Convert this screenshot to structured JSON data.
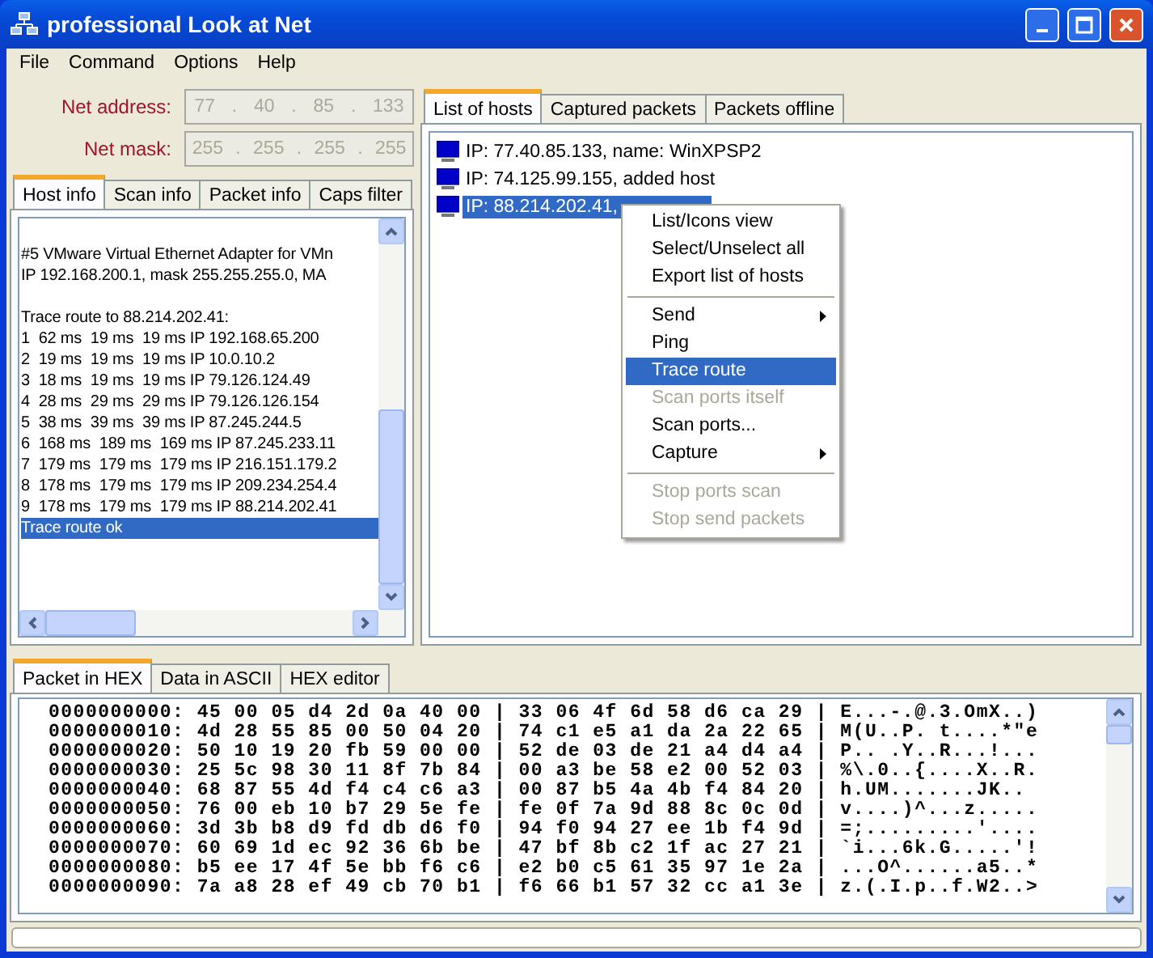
{
  "window": {
    "title": "professional Look at Net"
  },
  "menu": [
    "File",
    "Command",
    "Options",
    "Help"
  ],
  "net_fields": [
    {
      "label": "Net address:",
      "octets": [
        "77",
        "40",
        "85",
        "133"
      ],
      "separator": ".",
      "disabled": true
    },
    {
      "label": "Net mask:",
      "octets": [
        "255",
        "255",
        "255",
        "255"
      ],
      "separator": ".",
      "disabled": true
    }
  ],
  "left_tabs": [
    {
      "label": "Host info",
      "selected": true
    },
    {
      "label": "Scan info",
      "selected": false
    },
    {
      "label": "Packet info",
      "selected": false
    },
    {
      "label": "Caps filter",
      "selected": false
    }
  ],
  "host_info": {
    "blocks": [
      {
        "lines": [
          {
            "text": "#5 VMware Virtual Ethernet Adapter for VMn",
            "selected": false
          },
          {
            "text": "IP 192.168.200.1, mask 255.255.255.0, MA",
            "selected": false
          }
        ]
      },
      {
        "lines": [
          {
            "text": "Trace route to 88.214.202.41:",
            "selected": false
          },
          {
            "text": "1  62 ms  19 ms  19 ms IP 192.168.65.200",
            "selected": false
          },
          {
            "text": "2  19 ms  19 ms  19 ms IP 10.0.10.2",
            "selected": false
          },
          {
            "text": "3  18 ms  19 ms  19 ms IP 79.126.124.49",
            "selected": false
          },
          {
            "text": "4  28 ms  29 ms  29 ms IP 79.126.126.154",
            "selected": false
          },
          {
            "text": "5  38 ms  39 ms  39 ms IP 87.245.244.5",
            "selected": false
          },
          {
            "text": "6  168 ms  189 ms  169 ms IP 87.245.233.11",
            "selected": false
          },
          {
            "text": "7  179 ms  179 ms  179 ms IP 216.151.179.2",
            "selected": false
          },
          {
            "text": "8  178 ms  179 ms  179 ms IP 209.234.254.4",
            "selected": false
          },
          {
            "text": "9  178 ms  179 ms  179 ms IP 88.214.202.41",
            "selected": false
          },
          {
            "text": "Trace route ok",
            "selected": true
          }
        ]
      }
    ]
  },
  "right_tabs": [
    {
      "label": "List of hosts",
      "selected": true
    },
    {
      "label": "Captured packets",
      "selected": false
    },
    {
      "label": "Packets offline",
      "selected": false
    }
  ],
  "hosts": [
    {
      "text": "IP: 77.40.85.133, name: WinXPSP2",
      "selected": false
    },
    {
      "text": "IP: 74.125.99.155, added host",
      "selected": false
    },
    {
      "text": "IP: 88.214.202.41,",
      "selected": true
    }
  ],
  "context_menu": [
    {
      "kind": "item",
      "label": "List/Icons view",
      "disabled": false,
      "selected": false,
      "submenu": false
    },
    {
      "kind": "item",
      "label": "Select/Unselect all",
      "disabled": false,
      "selected": false,
      "submenu": false
    },
    {
      "kind": "item",
      "label": "Export list of hosts",
      "disabled": false,
      "selected": false,
      "submenu": false
    },
    {
      "kind": "separator"
    },
    {
      "kind": "item",
      "label": "Send",
      "disabled": false,
      "selected": false,
      "submenu": true
    },
    {
      "kind": "item",
      "label": "Ping",
      "disabled": false,
      "selected": false,
      "submenu": false
    },
    {
      "kind": "item",
      "label": "Trace route",
      "disabled": false,
      "selected": true,
      "submenu": false
    },
    {
      "kind": "item",
      "label": "Scan ports itself",
      "disabled": true,
      "selected": false,
      "submenu": false
    },
    {
      "kind": "item",
      "label": "Scan ports...",
      "disabled": false,
      "selected": false,
      "submenu": false
    },
    {
      "kind": "item",
      "label": "Capture",
      "disabled": false,
      "selected": false,
      "submenu": true
    },
    {
      "kind": "separator"
    },
    {
      "kind": "item",
      "label": "Stop ports scan",
      "disabled": true,
      "selected": false,
      "submenu": false
    },
    {
      "kind": "item",
      "label": "Stop send packets",
      "disabled": true,
      "selected": false,
      "submenu": false
    }
  ],
  "bottom_tabs": [
    {
      "label": "Packet in HEX",
      "selected": true
    },
    {
      "label": "Data in ASCII",
      "selected": false
    },
    {
      "label": "HEX editor",
      "selected": false
    }
  ],
  "hex_rows": [
    {
      "offset": "0000000000:",
      "bytes": "45 00 05 d4 2d 0a 40 00 | 33 06 4f 6d 58 d6 ca 29 |",
      "ascii": "E...-.@.3.OmX..)"
    },
    {
      "offset": "0000000010:",
      "bytes": "4d 28 55 85 00 50 04 20 | 74 c1 e5 a1 da 2a 22 65 |",
      "ascii": "M(U..P. t....*\"e"
    },
    {
      "offset": "0000000020:",
      "bytes": "50 10 19 20 fb 59 00 00 | 52 de 03 de 21 a4 d4 a4 |",
      "ascii": "P.. .Y..R...!..."
    },
    {
      "offset": "0000000030:",
      "bytes": "25 5c 98 30 11 8f 7b 84 | 00 a3 be 58 e2 00 52 03 |",
      "ascii": "%\\.0..{....X..R."
    },
    {
      "offset": "0000000040:",
      "bytes": "68 87 55 4d f4 c4 c6 a3 | 00 87 b5 4a 4b f4 84 20 |",
      "ascii": "h.UM.......JK.."
    },
    {
      "offset": "0000000050:",
      "bytes": "76 00 eb 10 b7 29 5e fe | fe 0f 7a 9d 88 8c 0c 0d |",
      "ascii": "v....)^...z....."
    },
    {
      "offset": "0000000060:",
      "bytes": "3d 3b b8 d9 fd db d6 f0 | 94 f0 94 27 ee 1b f4 9d |",
      "ascii": "=;.........'...."
    },
    {
      "offset": "0000000070:",
      "bytes": "60 69 1d ec 92 36 6b be | 47 bf 8b c2 1f ac 27 21 |",
      "ascii": "`i...6k.G.....'!"
    },
    {
      "offset": "0000000080:",
      "bytes": "b5 ee 17 4f 5e bb f6 c6 | e2 b0 c5 61 35 97 1e 2a |",
      "ascii": "...O^......a5..*"
    },
    {
      "offset": "0000000090:",
      "bytes": "7a a8 28 ef 49 cb 70 b1 | f6 66 b1 57 32 cc a1 3e |",
      "ascii": "z.(.I.p..f.W2..>"
    }
  ]
}
